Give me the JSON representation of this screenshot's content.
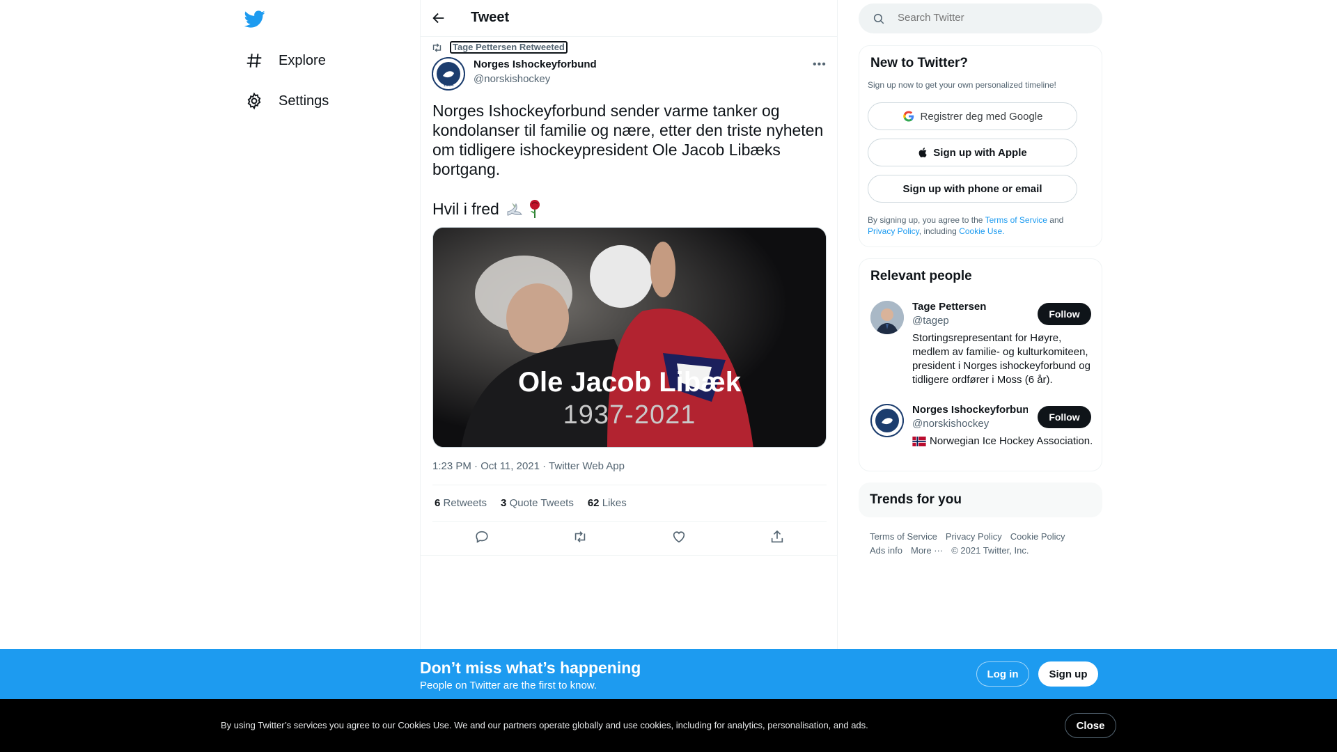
{
  "nav": {
    "items": [
      {
        "label": "Explore",
        "icon": "hashtag-icon"
      },
      {
        "label": "Settings",
        "icon": "gear-icon"
      }
    ]
  },
  "header": {
    "title": "Tweet"
  },
  "tweet": {
    "retweeted_by": "Tage Pettersen Retweeted",
    "author_name": "Norges Ishockeyforbund",
    "author_handle": "@norskishockey",
    "text": "Norges Ishockeyforbund sender varme tanker og kondolanser til familie og nære, etter den triste nyheten om tidligere ishockeypresident Ole Jacob Libæks bortgang.",
    "text2": "Hvil i fred",
    "image_name": "Ole Jacob Libæk",
    "image_years": "1937-2021",
    "meta": "1:23 PM · Oct 11, 2021 · Twitter Web App",
    "retweets_count": "6",
    "retweets_label": "Retweets",
    "quotes_count": "3",
    "quotes_label": "Quote Tweets",
    "likes_count": "62",
    "likes_label": "Likes"
  },
  "search": {
    "placeholder": "Search Twitter"
  },
  "signup_card": {
    "title": "New to Twitter?",
    "subtitle": "Sign up now to get your own personalized timeline!",
    "google_label": "Registrer deg med Google",
    "apple_label": "Sign up with Apple",
    "phone_label": "Sign up with phone or email",
    "legal_prefix": "By signing up, you agree to the",
    "terms": "Terms of Service",
    "and": "and",
    "privacy": "Privacy Policy",
    "including": ", including",
    "cookie_use": "Cookie Use."
  },
  "relevant_people": {
    "title": "Relevant people",
    "people": [
      {
        "name": "Tage Pettersen",
        "handle": "@tagep",
        "follow": "Follow",
        "bio": "Stortingsrepresentant for Høyre, medlem av familie- og kulturkomiteen, president i Norges ishockeyforbund og tidligere ordfører i Moss (6 år)."
      },
      {
        "name": "Norges Ishockeyforbund",
        "handle": "@norskishockey",
        "follow": "Follow",
        "bio": "Norwegian Ice Hockey Association."
      }
    ]
  },
  "trends": {
    "title": "Trends for you"
  },
  "footer": {
    "links": [
      "Terms of Service",
      "Privacy Policy",
      "Cookie Policy",
      "Ads info",
      "More ···",
      "© 2021 Twitter, Inc."
    ]
  },
  "banner": {
    "title": "Don’t miss what’s happening",
    "subtitle": "People on Twitter are the first to know.",
    "login": "Log in",
    "signup": "Sign up"
  },
  "cookie": {
    "text": "By using Twitter’s services you agree to our Cookies Use. We and our partners operate globally and use cookies, including for analytics, personalisation, and ads.",
    "close": "Close"
  },
  "colors": {
    "accent": "#1d9bf0",
    "text": "#0f1419",
    "secondary": "#536471",
    "border": "#eff3f4"
  }
}
